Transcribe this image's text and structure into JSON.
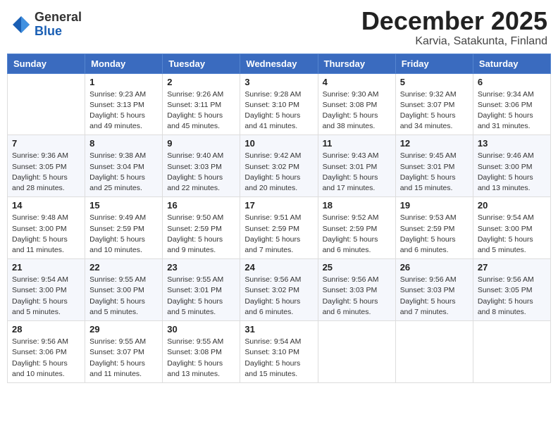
{
  "header": {
    "logo_general": "General",
    "logo_blue": "Blue",
    "month": "December 2025",
    "location": "Karvia, Satakunta, Finland"
  },
  "weekdays": [
    "Sunday",
    "Monday",
    "Tuesday",
    "Wednesday",
    "Thursday",
    "Friday",
    "Saturday"
  ],
  "weeks": [
    [
      {
        "day": "",
        "sunrise": "",
        "sunset": "",
        "daylight": ""
      },
      {
        "day": "1",
        "sunrise": "Sunrise: 9:23 AM",
        "sunset": "Sunset: 3:13 PM",
        "daylight": "Daylight: 5 hours and 49 minutes."
      },
      {
        "day": "2",
        "sunrise": "Sunrise: 9:26 AM",
        "sunset": "Sunset: 3:11 PM",
        "daylight": "Daylight: 5 hours and 45 minutes."
      },
      {
        "day": "3",
        "sunrise": "Sunrise: 9:28 AM",
        "sunset": "Sunset: 3:10 PM",
        "daylight": "Daylight: 5 hours and 41 minutes."
      },
      {
        "day": "4",
        "sunrise": "Sunrise: 9:30 AM",
        "sunset": "Sunset: 3:08 PM",
        "daylight": "Daylight: 5 hours and 38 minutes."
      },
      {
        "day": "5",
        "sunrise": "Sunrise: 9:32 AM",
        "sunset": "Sunset: 3:07 PM",
        "daylight": "Daylight: 5 hours and 34 minutes."
      },
      {
        "day": "6",
        "sunrise": "Sunrise: 9:34 AM",
        "sunset": "Sunset: 3:06 PM",
        "daylight": "Daylight: 5 hours and 31 minutes."
      }
    ],
    [
      {
        "day": "7",
        "sunrise": "Sunrise: 9:36 AM",
        "sunset": "Sunset: 3:05 PM",
        "daylight": "Daylight: 5 hours and 28 minutes."
      },
      {
        "day": "8",
        "sunrise": "Sunrise: 9:38 AM",
        "sunset": "Sunset: 3:04 PM",
        "daylight": "Daylight: 5 hours and 25 minutes."
      },
      {
        "day": "9",
        "sunrise": "Sunrise: 9:40 AM",
        "sunset": "Sunset: 3:03 PM",
        "daylight": "Daylight: 5 hours and 22 minutes."
      },
      {
        "day": "10",
        "sunrise": "Sunrise: 9:42 AM",
        "sunset": "Sunset: 3:02 PM",
        "daylight": "Daylight: 5 hours and 20 minutes."
      },
      {
        "day": "11",
        "sunrise": "Sunrise: 9:43 AM",
        "sunset": "Sunset: 3:01 PM",
        "daylight": "Daylight: 5 hours and 17 minutes."
      },
      {
        "day": "12",
        "sunrise": "Sunrise: 9:45 AM",
        "sunset": "Sunset: 3:01 PM",
        "daylight": "Daylight: 5 hours and 15 minutes."
      },
      {
        "day": "13",
        "sunrise": "Sunrise: 9:46 AM",
        "sunset": "Sunset: 3:00 PM",
        "daylight": "Daylight: 5 hours and 13 minutes."
      }
    ],
    [
      {
        "day": "14",
        "sunrise": "Sunrise: 9:48 AM",
        "sunset": "Sunset: 3:00 PM",
        "daylight": "Daylight: 5 hours and 11 minutes."
      },
      {
        "day": "15",
        "sunrise": "Sunrise: 9:49 AM",
        "sunset": "Sunset: 2:59 PM",
        "daylight": "Daylight: 5 hours and 10 minutes."
      },
      {
        "day": "16",
        "sunrise": "Sunrise: 9:50 AM",
        "sunset": "Sunset: 2:59 PM",
        "daylight": "Daylight: 5 hours and 9 minutes."
      },
      {
        "day": "17",
        "sunrise": "Sunrise: 9:51 AM",
        "sunset": "Sunset: 2:59 PM",
        "daylight": "Daylight: 5 hours and 7 minutes."
      },
      {
        "day": "18",
        "sunrise": "Sunrise: 9:52 AM",
        "sunset": "Sunset: 2:59 PM",
        "daylight": "Daylight: 5 hours and 6 minutes."
      },
      {
        "day": "19",
        "sunrise": "Sunrise: 9:53 AM",
        "sunset": "Sunset: 2:59 PM",
        "daylight": "Daylight: 5 hours and 6 minutes."
      },
      {
        "day": "20",
        "sunrise": "Sunrise: 9:54 AM",
        "sunset": "Sunset: 3:00 PM",
        "daylight": "Daylight: 5 hours and 5 minutes."
      }
    ],
    [
      {
        "day": "21",
        "sunrise": "Sunrise: 9:54 AM",
        "sunset": "Sunset: 3:00 PM",
        "daylight": "Daylight: 5 hours and 5 minutes."
      },
      {
        "day": "22",
        "sunrise": "Sunrise: 9:55 AM",
        "sunset": "Sunset: 3:00 PM",
        "daylight": "Daylight: 5 hours and 5 minutes."
      },
      {
        "day": "23",
        "sunrise": "Sunrise: 9:55 AM",
        "sunset": "Sunset: 3:01 PM",
        "daylight": "Daylight: 5 hours and 5 minutes."
      },
      {
        "day": "24",
        "sunrise": "Sunrise: 9:56 AM",
        "sunset": "Sunset: 3:02 PM",
        "daylight": "Daylight: 5 hours and 6 minutes."
      },
      {
        "day": "25",
        "sunrise": "Sunrise: 9:56 AM",
        "sunset": "Sunset: 3:03 PM",
        "daylight": "Daylight: 5 hours and 6 minutes."
      },
      {
        "day": "26",
        "sunrise": "Sunrise: 9:56 AM",
        "sunset": "Sunset: 3:03 PM",
        "daylight": "Daylight: 5 hours and 7 minutes."
      },
      {
        "day": "27",
        "sunrise": "Sunrise: 9:56 AM",
        "sunset": "Sunset: 3:05 PM",
        "daylight": "Daylight: 5 hours and 8 minutes."
      }
    ],
    [
      {
        "day": "28",
        "sunrise": "Sunrise: 9:56 AM",
        "sunset": "Sunset: 3:06 PM",
        "daylight": "Daylight: 5 hours and 10 minutes."
      },
      {
        "day": "29",
        "sunrise": "Sunrise: 9:55 AM",
        "sunset": "Sunset: 3:07 PM",
        "daylight": "Daylight: 5 hours and 11 minutes."
      },
      {
        "day": "30",
        "sunrise": "Sunrise: 9:55 AM",
        "sunset": "Sunset: 3:08 PM",
        "daylight": "Daylight: 5 hours and 13 minutes."
      },
      {
        "day": "31",
        "sunrise": "Sunrise: 9:54 AM",
        "sunset": "Sunset: 3:10 PM",
        "daylight": "Daylight: 5 hours and 15 minutes."
      },
      {
        "day": "",
        "sunrise": "",
        "sunset": "",
        "daylight": ""
      },
      {
        "day": "",
        "sunrise": "",
        "sunset": "",
        "daylight": ""
      },
      {
        "day": "",
        "sunrise": "",
        "sunset": "",
        "daylight": ""
      }
    ]
  ]
}
